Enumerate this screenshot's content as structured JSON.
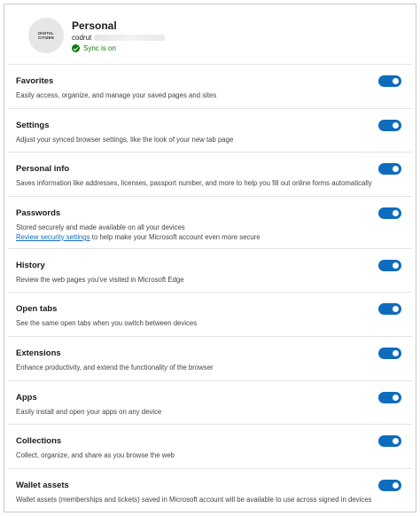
{
  "profile": {
    "name": "Personal",
    "email": "codrut",
    "sync_status": "Sync is on",
    "avatar_line1": "DIGITAL",
    "avatar_line2": "CITIZEN"
  },
  "rows": [
    {
      "title": "Favorites",
      "desc": "Easily access, organize, and manage your saved pages and sites",
      "enabled": true
    },
    {
      "title": "Settings",
      "desc": "Adjust your synced browser settings, like the look of your new tab page",
      "enabled": true
    },
    {
      "title": "Personal info",
      "desc": "Saves information like addresses, licenses, passport number, and more to help you fill out online forms automatically",
      "enabled": true
    },
    {
      "title": "Passwords",
      "desc": "Stored securely and made available on all your devices",
      "link": "Review security settings",
      "desc_after_link": " to help make your Microsoft account even more secure",
      "enabled": true
    },
    {
      "title": "History",
      "desc": "Review the web pages you've visited in Microsoft Edge",
      "enabled": true
    },
    {
      "title": "Open tabs",
      "desc": "See the same open tabs when you switch between devices",
      "enabled": true
    },
    {
      "title": "Extensions",
      "desc": "Enhance productivity, and extend the functionality of the browser",
      "enabled": true
    },
    {
      "title": "Apps",
      "desc": "Easily install and open your apps on any device",
      "enabled": true
    },
    {
      "title": "Collections",
      "desc": "Collect, organize, and share as you browse the web",
      "enabled": true
    },
    {
      "title": "Wallet assets",
      "desc": "Wallet assets (memberships and tickets) saved in Microsoft account will be available to use across signed in devices",
      "enabled": true
    }
  ],
  "colors": {
    "accent": "#0f6cbd",
    "sync_green": "#107c10"
  }
}
